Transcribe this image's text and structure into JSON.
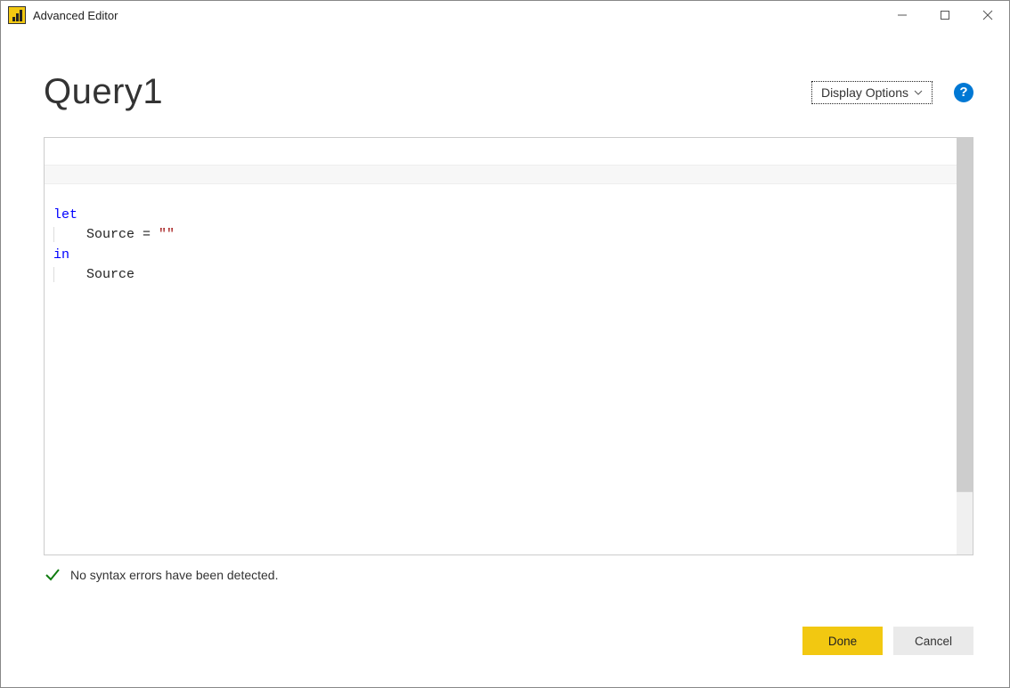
{
  "window": {
    "title": "Advanced Editor"
  },
  "header": {
    "query_title": "Query1",
    "display_options_label": "Display Options"
  },
  "editor": {
    "code": {
      "keyword_let": "let",
      "line2_variable": "    Source = ",
      "line2_string": "\"\"",
      "keyword_in": "in",
      "line4_variable": "    Source"
    }
  },
  "status": {
    "message": "No syntax errors have been detected."
  },
  "buttons": {
    "done": "Done",
    "cancel": "Cancel"
  }
}
